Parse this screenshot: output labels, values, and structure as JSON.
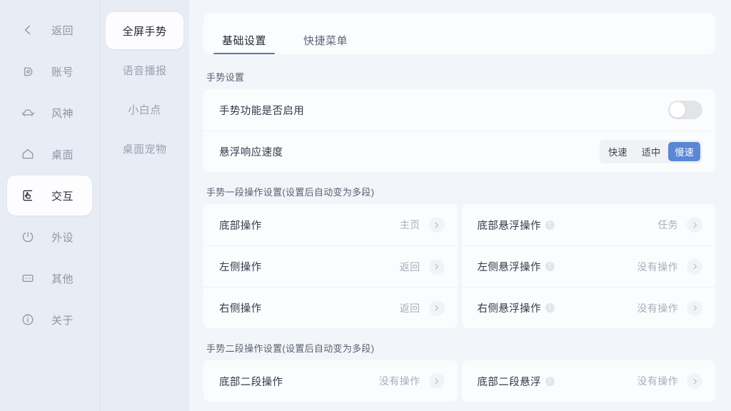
{
  "sidebar": {
    "items": [
      {
        "id": "back",
        "label": "返回",
        "icon": "chevron-left-icon",
        "active": false
      },
      {
        "id": "account",
        "label": "账号",
        "icon": "account-icon",
        "active": false
      },
      {
        "id": "fengshen",
        "label": "风神",
        "icon": "car-icon",
        "active": false
      },
      {
        "id": "desktop",
        "label": "桌面",
        "icon": "home-icon",
        "active": false
      },
      {
        "id": "interact",
        "label": "交互",
        "icon": "tap-gesture-icon",
        "active": true
      },
      {
        "id": "periph",
        "label": "外设",
        "icon": "alert-icon",
        "active": false
      },
      {
        "id": "other",
        "label": "其他",
        "icon": "more-icon",
        "active": false
      },
      {
        "id": "about",
        "label": "关于",
        "icon": "info-circle-icon",
        "active": false
      }
    ]
  },
  "subnav": {
    "items": [
      {
        "id": "fullscreen-gesture",
        "label": "全屏手势",
        "active": true
      },
      {
        "id": "voice-broadcast",
        "label": "语音播报",
        "active": false
      },
      {
        "id": "assistive-touch",
        "label": "小白点",
        "active": false
      },
      {
        "id": "desktop-pet",
        "label": "桌面宠物",
        "active": false
      }
    ]
  },
  "tabs": [
    {
      "id": "basic",
      "label": "基础设置",
      "active": true
    },
    {
      "id": "shortcut",
      "label": "快捷菜单",
      "active": false
    }
  ],
  "sections": [
    {
      "id": "gesture-settings",
      "title": "手势设置",
      "rows": [
        {
          "id": "gesture-enabled",
          "label": "手势功能是否启用",
          "control": "toggle",
          "enabled": false
        },
        {
          "id": "hover-response-speed",
          "label": "悬浮响应速度",
          "control": "segmented",
          "options": [
            "快速",
            "适中",
            "慢速"
          ],
          "selected": "慢速"
        }
      ]
    },
    {
      "id": "stage-one",
      "title": "手势一段操作设置(设置后自动变为多段)",
      "left": [
        {
          "id": "bottom-action",
          "label": "底部操作",
          "value": "主页",
          "info": false
        },
        {
          "id": "left-action",
          "label": "左侧操作",
          "value": "返回",
          "info": false
        },
        {
          "id": "right-action",
          "label": "右侧操作",
          "value": "返回",
          "info": false
        }
      ],
      "right": [
        {
          "id": "bottom-hover-action",
          "label": "底部悬浮操作",
          "value": "任务",
          "info": true
        },
        {
          "id": "left-hover-action",
          "label": "左侧悬浮操作",
          "value": "没有操作",
          "info": true
        },
        {
          "id": "right-hover-action",
          "label": "右侧悬浮操作",
          "value": "没有操作",
          "info": true
        }
      ]
    },
    {
      "id": "stage-two",
      "title": "手势二段操作设置(设置后自动变为多段)",
      "left": [
        {
          "id": "bottom-two-stage-action",
          "label": "底部二段操作",
          "value": "没有操作",
          "info": false
        }
      ],
      "right": [
        {
          "id": "bottom-two-stage-hover",
          "label": "底部二段悬浮",
          "value": "没有操作",
          "info": true
        }
      ]
    }
  ],
  "colors": {
    "accent": "#5b87d6",
    "tab_underline": "#5b7aa8",
    "page_background": "#f2f5f9",
    "sidebar_background": "#e8ecf4",
    "card_background": "#fbfcfe",
    "muted_text": "#a8aeba"
  }
}
